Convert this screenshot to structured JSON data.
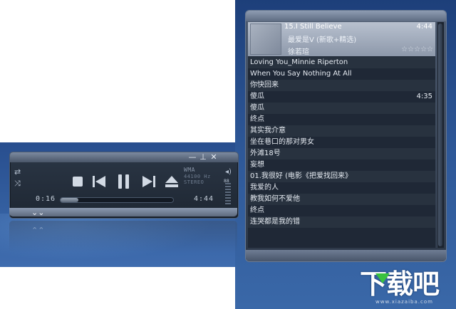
{
  "player": {
    "format": "WMA",
    "bitrate": "44100 Hz",
    "channels": "STEREO",
    "elapsed": "0:16",
    "total": "4:44",
    "progress": 0.16,
    "volume_label": "88",
    "icons": {
      "minimize": "—",
      "pin": "⊥",
      "close": "✕",
      "expand": "⌄⌄",
      "collapse": "⌃⌃"
    }
  },
  "playlist": {
    "now_playing": {
      "title": "15.I Still Believe",
      "duration": "4:44",
      "album": "最爱是V (新歌+精选)",
      "artist": "徐若瑄",
      "rating": "☆☆☆☆☆"
    },
    "items": [
      {
        "title": "Loving You_Minnie Riperton",
        "duration": ""
      },
      {
        "title": "When You Say Nothing At All",
        "duration": ""
      },
      {
        "title": "你快回来",
        "duration": ""
      },
      {
        "title": "傻瓜",
        "duration": "4:35"
      },
      {
        "title": "傻瓜",
        "duration": ""
      },
      {
        "title": "终点",
        "duration": ""
      },
      {
        "title": "其实我介意",
        "duration": ""
      },
      {
        "title": "坐在巷口的那对男女",
        "duration": ""
      },
      {
        "title": "外滩18号",
        "duration": ""
      },
      {
        "title": "妄想",
        "duration": ""
      },
      {
        "title": "01.我很好 (电影《把爱找回来》",
        "duration": ""
      },
      {
        "title": "我爱的人",
        "duration": ""
      },
      {
        "title": "教我如何不爱他",
        "duration": ""
      },
      {
        "title": "终点",
        "duration": ""
      },
      {
        "title": "连哭都是我的错",
        "duration": ""
      }
    ]
  },
  "watermark": {
    "logo_text": "下载吧",
    "site": "www.xiazaiba.com"
  },
  "colors": {
    "background_blue": "#2e5898",
    "panel_dark": "#1f2836",
    "logo_green": "#39c23f"
  }
}
